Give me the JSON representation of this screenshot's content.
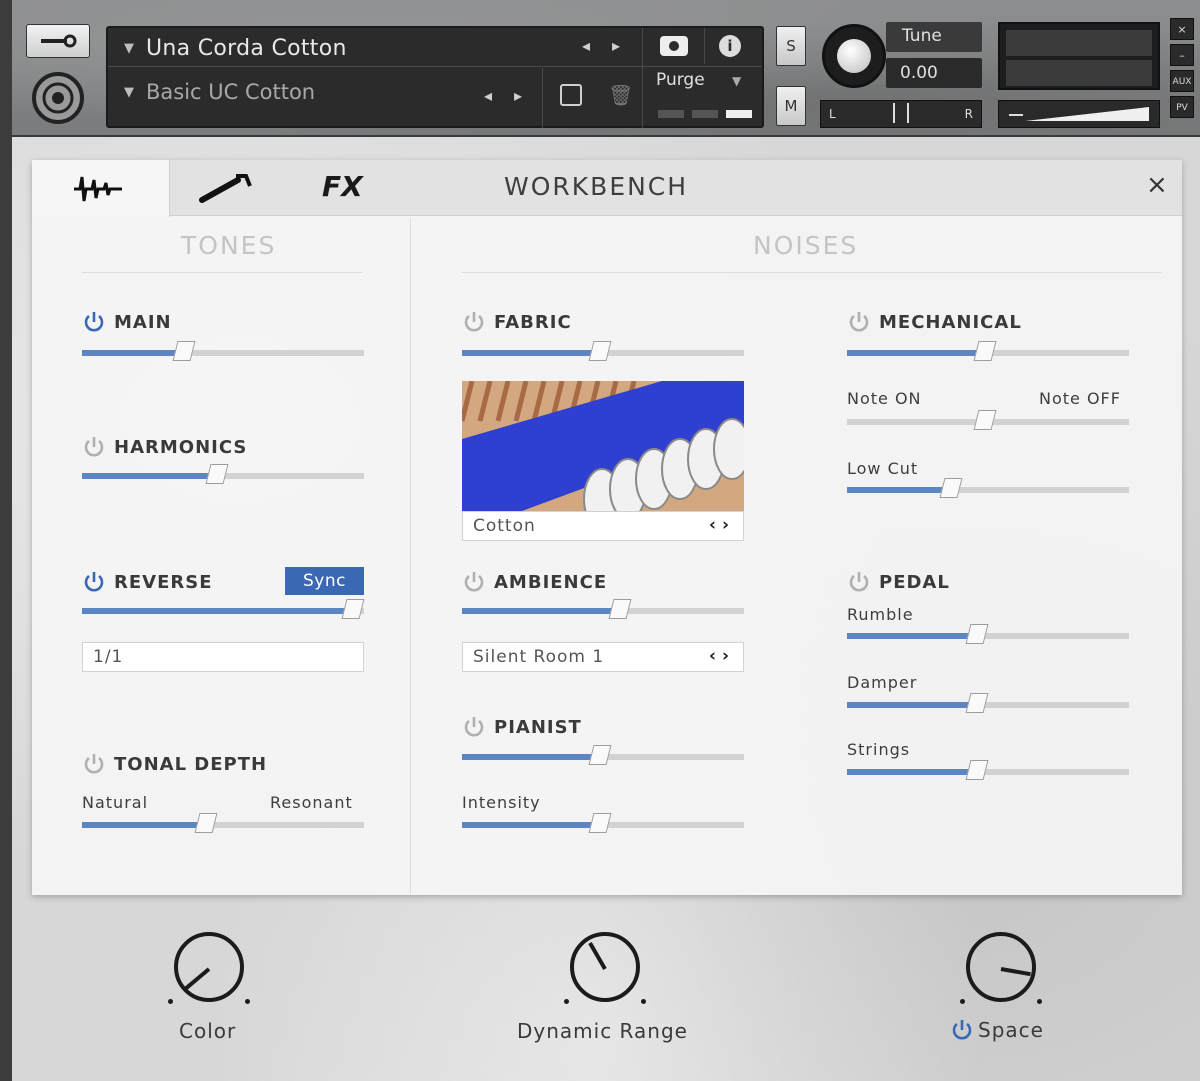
{
  "header": {
    "instrument_name": "Una Corda Cotton",
    "preset_name": "Basic UC Cotton",
    "purge_label": "Purge",
    "solo_label": "S",
    "mute_label": "M",
    "tune_label": "Tune",
    "tune_value": "0.00",
    "pan_left": "L",
    "pan_right": "R",
    "close_label": "×",
    "minimize_label": "–",
    "aux_label": "AUX",
    "pv_label": "PV"
  },
  "tabs": {
    "fx_label": "FX",
    "title": "WORKBENCH",
    "close": "×"
  },
  "tones": {
    "title": "TONES",
    "main": {
      "label": "MAIN",
      "value": 0.36,
      "enabled": true
    },
    "harmonics": {
      "label": "HARMONICS",
      "value": 0.48,
      "enabled": false
    },
    "reverse": {
      "label": "REVERSE",
      "sync_label": "Sync",
      "value": 0.96,
      "enabled": true,
      "division": "1/1"
    },
    "tonal_depth": {
      "label": "TONAL DEPTH",
      "left_label": "Natural",
      "right_label": "Resonant",
      "value": 0.44,
      "enabled": false
    }
  },
  "noises": {
    "title": "NOISES",
    "fabric": {
      "label": "FABRIC",
      "value": 0.49,
      "enabled": false,
      "selection": "Cotton"
    },
    "ambience": {
      "label": "AMBIENCE",
      "value": 0.56,
      "enabled": false,
      "selection": "Silent Room 1"
    },
    "pianist": {
      "label": "PIANIST",
      "value": 0.49,
      "enabled": false,
      "intensity_label": "Intensity",
      "intensity_value": 0.49
    },
    "mechanical": {
      "label": "MECHANICAL",
      "value": 0.49,
      "enabled": false,
      "note_on_label": "Note ON",
      "note_off_label": "Note OFF",
      "note_balance": 0.49,
      "low_cut_label": "Low Cut",
      "low_cut_value": 0.37
    },
    "pedal": {
      "label": "PEDAL",
      "enabled": false,
      "rumble_label": "Rumble",
      "rumble_value": 0.46,
      "damper_label": "Damper",
      "damper_value": 0.46,
      "strings_label": "Strings",
      "strings_value": 0.46
    }
  },
  "bottom": {
    "color_label": "Color",
    "dynamic_range_label": "Dynamic Range",
    "space_label": "Space"
  },
  "colors": {
    "accent": "#3b68b4",
    "slider_fill": "#5b85c3",
    "fabric_blue": "#2f3fd0"
  }
}
